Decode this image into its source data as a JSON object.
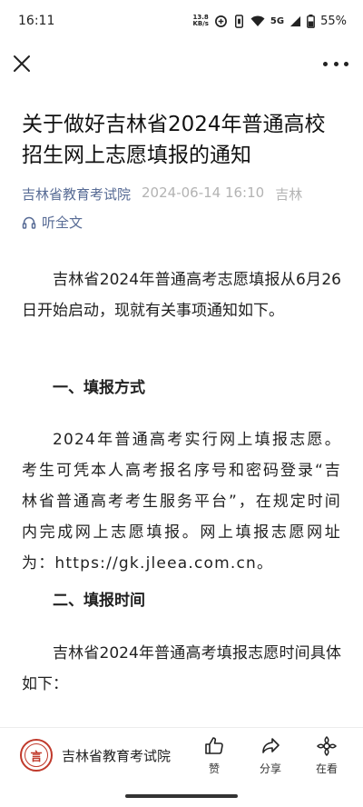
{
  "status": {
    "time": "16:11",
    "net_speed_value": "13.8",
    "net_speed_unit": "KB/s",
    "network": "5G",
    "battery": "55%"
  },
  "nav": {
    "close_icon": "close-icon",
    "more_icon": "more-icon"
  },
  "article": {
    "title": "关于做好吉林省2024年普通高校招生网上志愿填报的通知",
    "source": "吉林省教育考试院",
    "date": "2024-06-14 16:10",
    "region": "吉林",
    "listen_label": "听全文",
    "paragraph1": "吉林省2024年普通高考志愿填报从6月26日开始启动，现就有关事项通知如下。",
    "heading1": "一、填报方式",
    "paragraph2": "2024年普通高考实行网上填报志愿。考生可凭本人高考报名序号和密码登录“吉林省普通高考考生服务平台”，在规定时间内完成网上志愿填报。网上填报志愿网址为：https://gk.jleea.com.cn。",
    "heading2": "二、填报时间",
    "paragraph3": "吉林省2024年普通高考填报志愿时间具体如下："
  },
  "bottom_bar": {
    "account_name": "吉林省教育考试院",
    "avatar_glyph": "言",
    "like_label": "赞",
    "share_label": "分享",
    "watching_label": "在看"
  },
  "colors": {
    "link": "#576b95",
    "meta_gray": "#b3b3b3",
    "seal_red": "#c0392b"
  }
}
